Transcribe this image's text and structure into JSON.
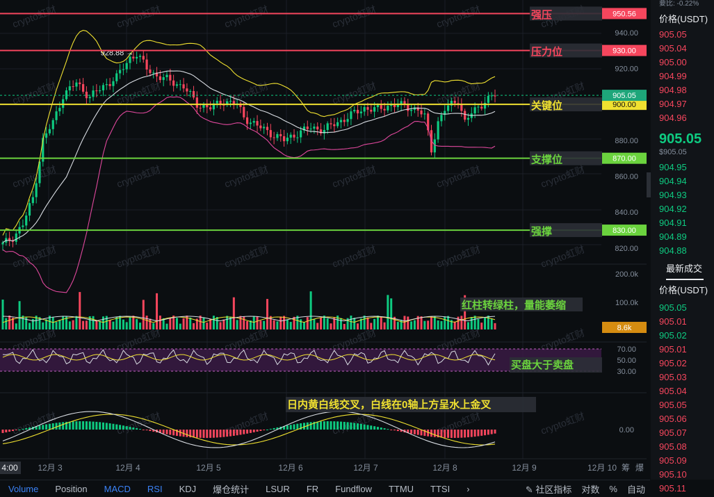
{
  "chart_data": {
    "type": "candlestick",
    "price_axis": {
      "ticks": [
        "940.00",
        "920.00",
        "900.00",
        "880.00",
        "860.00",
        "840.00",
        "820.00"
      ],
      "range": [
        813,
        955
      ]
    },
    "x_axis": {
      "labels": [
        "4:00",
        "12月 3",
        "12月 4",
        "12月 5",
        "12月 6",
        "12月 7",
        "12月 8",
        "12月 9",
        "12月 10"
      ]
    },
    "high_marker": "928.88 →",
    "current_price": 905.05,
    "levels": [
      {
        "name": "强压",
        "price": "950.56",
        "value": 950.56,
        "color": "#f6465d"
      },
      {
        "name": "压力位",
        "price": "930.00",
        "value": 930.0,
        "color": "#f6465d"
      },
      {
        "name": "关键位",
        "price": "900.00",
        "value": 900.0,
        "color": "#f0e130"
      },
      {
        "name": "支撑位",
        "price": "870.00",
        "value": 870.0,
        "color": "#6bd33e"
      },
      {
        "name": "强撑",
        "price": "830.00",
        "value": 830.0,
        "color": "#6bd33e"
      }
    ],
    "price_key_points": [
      [
        0,
        822
      ],
      [
        3,
        826
      ],
      [
        6,
        833
      ],
      [
        9,
        848
      ],
      [
        12,
        880
      ],
      [
        15,
        890
      ],
      [
        18,
        905
      ],
      [
        22,
        912
      ],
      [
        26,
        904
      ],
      [
        30,
        910
      ],
      [
        34,
        915
      ],
      [
        38,
        926
      ],
      [
        40,
        928
      ],
      [
        43,
        920
      ],
      [
        46,
        916
      ],
      [
        50,
        913
      ],
      [
        54,
        910
      ],
      [
        58,
        900
      ],
      [
        62,
        898
      ],
      [
        66,
        902
      ],
      [
        70,
        900
      ],
      [
        72,
        893
      ],
      [
        76,
        888
      ],
      [
        80,
        884
      ],
      [
        84,
        880
      ],
      [
        88,
        884
      ],
      [
        92,
        887
      ],
      [
        96,
        886
      ],
      [
        100,
        890
      ],
      [
        104,
        894
      ],
      [
        108,
        898
      ],
      [
        112,
        897
      ],
      [
        116,
        900
      ],
      [
        120,
        899
      ],
      [
        124,
        897
      ],
      [
        126,
        893
      ],
      [
        128,
        875
      ],
      [
        130,
        890
      ],
      [
        132,
        897
      ],
      [
        136,
        903
      ],
      [
        138,
        890
      ],
      [
        140,
        895
      ],
      [
        144,
        902
      ],
      [
        147,
        905
      ]
    ],
    "volume": {
      "ticks": [
        "200.0k",
        "100.0k"
      ],
      "current_label": "8.6k",
      "note": "红柱转绿柱，量能萎缩"
    },
    "rsi": {
      "ticks": [
        "70.00",
        "50.00",
        "30.00"
      ],
      "note": "买盘大于卖盘"
    },
    "macd": {
      "ticks": [
        "0.00"
      ],
      "note": "日内黄白线交叉，白线在0轴上方呈水上金叉"
    }
  },
  "order_book": {
    "header_clip": "要比: -0.22%",
    "price_label": "价格(USDT)",
    "asks": [
      "905.05",
      "905.04",
      "905.00",
      "904.99",
      "904.98",
      "904.97",
      "904.96"
    ],
    "last_price": "905.05",
    "last_price_sub": "$905.05",
    "bids": [
      "904.95",
      "904.94",
      "904.93",
      "904.92",
      "904.91",
      "904.89",
      "904.88"
    ],
    "trades_title": "最新成交",
    "trades_price_label": "价格(USDT)",
    "trades": [
      {
        "p": "905.05",
        "c": "green"
      },
      {
        "p": "905.01",
        "c": "red"
      },
      {
        "p": "905.02",
        "c": "green"
      },
      {
        "p": "905.01",
        "c": "red"
      },
      {
        "p": "905.02",
        "c": "red"
      },
      {
        "p": "905.03",
        "c": "red"
      },
      {
        "p": "905.04",
        "c": "red"
      },
      {
        "p": "905.05",
        "c": "red"
      },
      {
        "p": "905.06",
        "c": "red"
      },
      {
        "p": "905.07",
        "c": "red"
      },
      {
        "p": "905.08",
        "c": "red"
      },
      {
        "p": "905.09",
        "c": "red"
      },
      {
        "p": "905.10",
        "c": "red"
      },
      {
        "p": "905.11",
        "c": "red"
      }
    ]
  },
  "tabs": [
    "Volume",
    "Position",
    "MACD",
    "RSI",
    "KDJ",
    "爆仓统计",
    "LSUR",
    "FR",
    "Fundflow",
    "TTMU",
    "TTSI"
  ],
  "tabs_active": [
    "Volume",
    "MACD",
    "RSI"
  ],
  "tabs_right": [
    "社区指标",
    "对数",
    "%",
    "自动"
  ],
  "watermark": "crypto虹财",
  "colors": {
    "up": "#0ecb81",
    "down": "#f6465d",
    "bg": "#0b0e11",
    "grid": "#1b1f26",
    "yellow": "#f0e130",
    "white": "#d9dde3",
    "pink": "#e0489d"
  }
}
